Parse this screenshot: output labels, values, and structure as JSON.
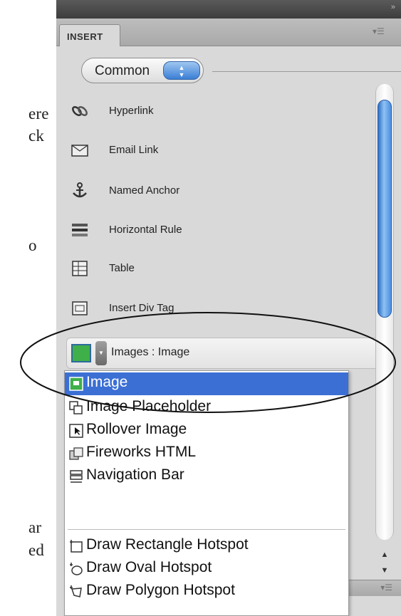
{
  "page_text": {
    "frag1": "ere",
    "frag2": "ck",
    "frag3": "o",
    "frag4": "ar",
    "frag5": "ed"
  },
  "panel": {
    "tab_label": "INSERT",
    "collapse_icon": "double-chevron-icon",
    "menu_icon": "panel-menu-icon"
  },
  "category_select": {
    "value": "Common"
  },
  "insert_items": [
    {
      "label": "Hyperlink",
      "icon": "hyperlink-icon"
    },
    {
      "label": "Email Link",
      "icon": "email-link-icon"
    },
    {
      "label": "Named Anchor",
      "icon": "anchor-icon"
    },
    {
      "label": "Horizontal Rule",
      "icon": "horizontal-rule-icon"
    },
    {
      "label": "Table",
      "icon": "table-icon"
    },
    {
      "label": "Insert Div Tag",
      "icon": "div-tag-icon"
    }
  ],
  "images_row": {
    "label": "Images : Image",
    "icon": "image-icon"
  },
  "dropdown": {
    "items": [
      {
        "label": "Image",
        "icon": "image-icon",
        "selected": true
      },
      {
        "label": "Image Placeholder",
        "icon": "image-placeholder-icon",
        "selected": false
      },
      {
        "label": "Rollover Image",
        "icon": "rollover-image-icon",
        "selected": false
      },
      {
        "label": "Fireworks HTML",
        "icon": "fireworks-icon",
        "selected": false
      },
      {
        "label": "Navigation Bar",
        "icon": "navigation-bar-icon",
        "selected": false
      },
      {
        "label": "Draw Rectangle Hotspot",
        "icon": "rectangle-hotspot-icon",
        "selected": false
      },
      {
        "label": "Draw Oval Hotspot",
        "icon": "oval-hotspot-icon",
        "selected": false
      },
      {
        "label": "Draw Polygon Hotspot",
        "icon": "polygon-hotspot-icon",
        "selected": false
      }
    ]
  },
  "colors": {
    "selection": "#3b6fd4",
    "scroll_thumb": "#4d8ee0"
  }
}
